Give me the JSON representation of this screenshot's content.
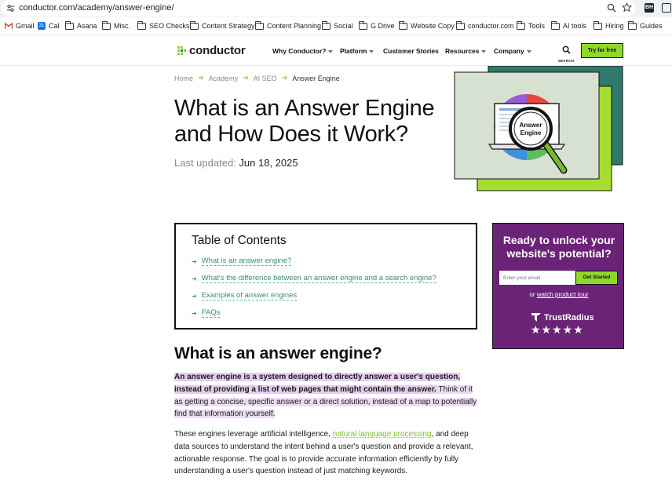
{
  "browser": {
    "url": "conductor.com/academy/answer-engine/",
    "profile_badge": "BH",
    "bookmarks": [
      "Gmail",
      "Cal",
      "Asana",
      "Misc.",
      "SEO Checks",
      "Content Strategy",
      "Content Planning",
      "Social",
      "G Drive",
      "Website Copy",
      "conductor.com",
      "Tools",
      "AI tools",
      "Hiring",
      "Guides"
    ],
    "cal_icon_text": "31"
  },
  "header": {
    "logo": "conductor",
    "nav": [
      "Why Conductor?",
      "Platform",
      "Customer Stories",
      "Resources",
      "Company"
    ],
    "search_label": "SEARCH",
    "cta": "Try for free"
  },
  "breadcrumb": [
    "Home",
    "Academy",
    "AI SEO",
    "Answer Engine"
  ],
  "hero": {
    "title": "What is an Answer Engine and How Does it Work?",
    "updated_label": "Last updated:",
    "updated_date": "Jun 18, 2025",
    "image_text": "Answer Engine"
  },
  "toc": {
    "title": "Table of Contents",
    "items": [
      "What is an answer engine?",
      "What's the difference between an answer engine and a search engine?",
      "Examples of answer engines",
      "FAQs"
    ]
  },
  "cta_box": {
    "title": "Ready to unlock your website's potential?",
    "email_placeholder": "Enter your email",
    "button": "Get Started",
    "or_text": "or",
    "tour_link": "watch product tour",
    "badge": "TrustRadius",
    "stars": "★★★★★"
  },
  "article": {
    "heading": "What is an answer engine?",
    "p1_bold": "An answer engine is a system designed to directly answer a user's question, instead of providing a list of web pages that might contain the answer.",
    "p1_rest": " Think of it as getting a concise, specific answer or a direct solution, instead of a map to potentially find that information yourself.",
    "p2_start": "These engines leverage artificial intelligence, ",
    "p2_link": "natural language processing",
    "p2_end": ", and deep data sources to understand the intent behind a user's question and provide a relevant, actionable response. The goal is to provide accurate information efficiently by fully understanding a user's question instead of just matching keywords."
  },
  "colors": {
    "brand_green": "#8fd82b",
    "cta_purple": "#6b2378",
    "teal": "#2e7a6c",
    "link_teal": "#3a8c6e",
    "highlight": "#ecdcf3"
  }
}
